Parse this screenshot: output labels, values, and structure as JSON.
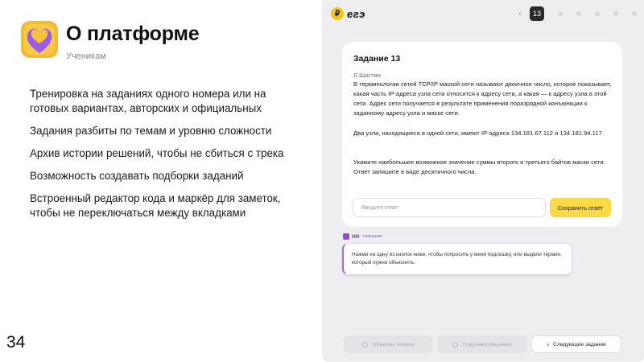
{
  "slide": {
    "title": "О платформе",
    "subtitle": "Ученикам",
    "page_number": "34",
    "bullets": [
      "Тренировка на заданиях одного номера или на готовых вариантах, авторских и официальных",
      "Задания разбиты по темам и уровню сложности",
      "Архив истории решений, чтобы не сбиться с трека",
      "Возможность создавать подборки заданий",
      "Встроенный редактор кода и маркёр для заметок, чтобы не переключаться между вкладками"
    ],
    "logo_colors": {
      "outer": "#f6b934",
      "heart_top": "#f5c33b",
      "heart_bottom": "#9b5de5"
    }
  },
  "app": {
    "logo_icon": "coin-icon",
    "logo_text": "егэ",
    "pager": {
      "current": "13",
      "prev_icon": "chevron-left-icon"
    },
    "task": {
      "title": "Задание 13",
      "author": "Л.Шастин",
      "paragraphs": [
        "В терминологии сетей TCP/IP маской сети называют двоичное число, которое показывает, какая часть IP-адреса узла сети относится к адресу сети, а какая — к адресу узла в этой сети. Адрес сети получается в результате применения поразрядной конъюнкции к заданному адресу узла и маске сети.",
        "Два узла, находящиеся в одной сети, имеют IP-адреса 134.181.67.112 и 134.181.94.117.",
        "Укажите наибольшее возможное значение суммы второго и третьего байтов маски сети. Ответ запишите в виде десятичного числа."
      ],
      "answer_placeholder": "Введите ответ",
      "answer_value": "",
      "save_label": "Сохранить ответ"
    },
    "assistant": {
      "name": "ИИ",
      "suffix": "-помощник",
      "message": "Нажми на одну из кнопок ниже, чтобы попросить у меня подсказку, или выдели термин, который нужно объяснить."
    },
    "actions": {
      "theory_label": "Объясни теорию",
      "hint_label": "Подскажи решение",
      "next_label": "Следующее задание"
    },
    "colors": {
      "save_button": "#fcd945",
      "assistant_accent": "#8e4fd6",
      "pager_current": "#2b2b2f"
    }
  }
}
